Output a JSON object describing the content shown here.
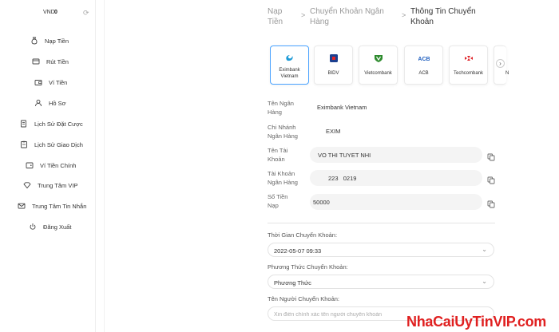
{
  "sidebar": {
    "balance_currency": "VND",
    "balance_amount": "0",
    "items": [
      {
        "label": "Nạp Tiền"
      },
      {
        "label": "Rút Tiền"
      },
      {
        "label": "Ví Tiền"
      },
      {
        "label": "Hồ Sơ"
      },
      {
        "label": "Lịch Sử Đặt Cược"
      },
      {
        "label": "Lịch Sử Giao Dịch"
      },
      {
        "label": "Ví Tiền Chính"
      },
      {
        "label": "Trung Tâm VIP"
      },
      {
        "label": "Trung Tâm Tin Nhắn"
      },
      {
        "label": "Đăng Xuất"
      }
    ]
  },
  "breadcrumb": {
    "step1": "Nạp\nTiền",
    "step2": "Chuyển Khoản Ngân\nHàng",
    "step3": "Thông Tin Chuyển\nKhoản",
    "sep": ">"
  },
  "banks": [
    {
      "name": "Eximbank Vietnam",
      "selected": true,
      "color": "#1e9bd7"
    },
    {
      "name": "BIDV",
      "selected": false,
      "color": "#1b3f8f"
    },
    {
      "name": "Vietcombank",
      "selected": false,
      "color": "#2e8b2e"
    },
    {
      "name": "ACB",
      "selected": false,
      "color": "#1f5fbf"
    },
    {
      "name": "Techcombank",
      "selected": false,
      "color": "#e0242a"
    },
    {
      "name": "N",
      "selected": false,
      "color": "#333333"
    }
  ],
  "details": {
    "bank_name_label": "Tên Ngân\nHàng",
    "bank_name_value": "Eximbank Vietnam",
    "branch_label": "Chi Nhánh\nNgân Hàng",
    "branch_value": "EXIM",
    "account_name_label": "Tên Tài\nKhoản",
    "account_name_value": "VO THI TUYET NHI",
    "account_number_label": "Tài Khoản\nNgân Hàng",
    "account_number_value": "223   0219",
    "amount_label": "Số Tiền\nNạp",
    "amount_value": "50000"
  },
  "form": {
    "time_label": "Thời Gian Chuyển Khoản:",
    "time_value": "2022-05-07 09:33",
    "method_label": "Phương Thức Chuyển Khoản:",
    "method_value": "Phương Thức",
    "sender_label": "Tên Người Chuyển Khoản:",
    "sender_placeholder": "Xin điền chính xác tên người chuyển khoản"
  },
  "watermark": "NhaCaiUyTinVIP.com",
  "colors": {
    "accent": "#4aa3ff",
    "watermark": "#e02020"
  }
}
